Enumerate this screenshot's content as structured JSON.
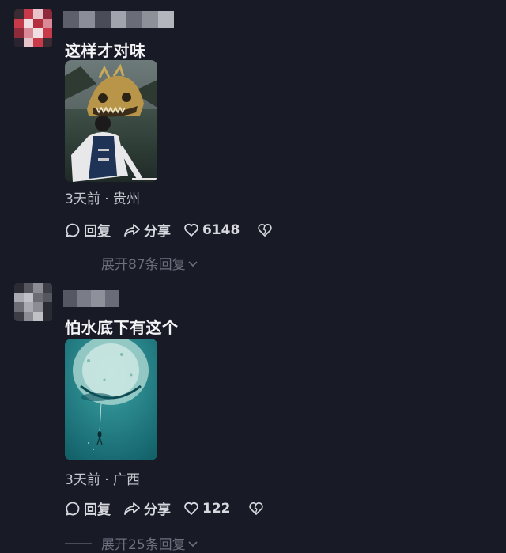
{
  "comments": [
    {
      "text": "这样才对味",
      "meta": "3天前 · 贵州",
      "reply_label": "回复",
      "share_label": "分享",
      "likes": "6148",
      "expand_label": "展开87条回复",
      "avatar_colors": [
        "#c8394a",
        "#e7c4c9",
        "#8d2b3a",
        "#f0dfe2",
        "#b5303f",
        "#d98a96"
      ]
    },
    {
      "text": "怕水底下有这个",
      "meta": "3天前 · 广西",
      "reply_label": "回复",
      "share_label": "分享",
      "likes": "122",
      "expand_label": "展开25条回复",
      "avatar_colors": [
        "#55565e",
        "#8c8d94",
        "#3c3d45",
        "#a9aab1",
        "#6b6c74",
        "#c0c1c6"
      ]
    }
  ],
  "colors": {
    "background": "#181a25",
    "text": "#f4f4f7",
    "muted": "#6e7080"
  }
}
